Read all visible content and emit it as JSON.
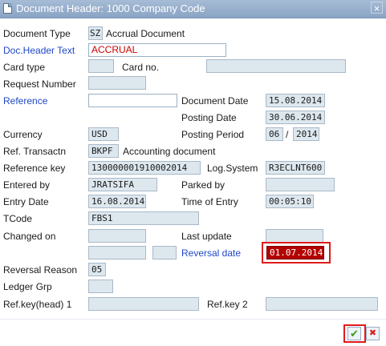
{
  "window": {
    "title": "Document Header: 1000 Company Code",
    "close_icon": "×"
  },
  "labels": {
    "document_type": "Document Type",
    "doc_header_text": "Doc.Header Text",
    "card_type": "Card type",
    "card_no": "Card no.",
    "request_number": "Request Number",
    "reference": "Reference",
    "document_date": "Document Date",
    "posting_date": "Posting Date",
    "currency": "Currency",
    "posting_period": "Posting Period",
    "ref_transactn": "Ref. Transactn",
    "reference_key": "Reference key",
    "log_system": "Log.System",
    "entered_by": "Entered by",
    "parked_by": "Parked by",
    "entry_date": "Entry Date",
    "time_of_entry": "Time of Entry",
    "tcode": "TCode",
    "changed_on": "Changed on",
    "last_update": "Last update",
    "reversal_date": "Reversal date",
    "reversal_reason": "Reversal Reason",
    "ledger_grp": "Ledger Grp",
    "ref_key_head_1": "Ref.key(head) 1",
    "ref_key_2": "Ref.key 2"
  },
  "values": {
    "document_type": "SZ",
    "document_type_desc": "Accrual Document",
    "doc_header_text": "ACCRUAL",
    "card_type": "",
    "card_no": "",
    "request_number": "",
    "reference": "",
    "document_date": "15.08.2014",
    "posting_date": "30.06.2014",
    "currency": "USD",
    "posting_period": "06",
    "period_separator": "/",
    "posting_year": "2014",
    "ref_transactn": "BKPF",
    "ref_transactn_desc": "Accounting document",
    "reference_key": "130000001910002014",
    "log_system": "R3ECLNT600",
    "entered_by": "JRATSIFA",
    "parked_by": "",
    "entry_date": "16.08.2014",
    "time_of_entry": "00:05:10",
    "tcode": "FBS1",
    "changed_on": "",
    "last_update": "",
    "extra_1": "",
    "extra_2": "",
    "reversal_date": "01.07.2014",
    "reversal_reason": "05",
    "ledger_grp": "",
    "ref_key_head_1": "",
    "ref_key_2": ""
  },
  "buttons": {
    "confirm_icon": "✔",
    "cancel_icon": "✖"
  },
  "colors": {
    "highlight": "#e01b1b",
    "link_label": "#1f47c8",
    "field_bg": "#dde7ee",
    "selected_bg": "#b30000"
  }
}
